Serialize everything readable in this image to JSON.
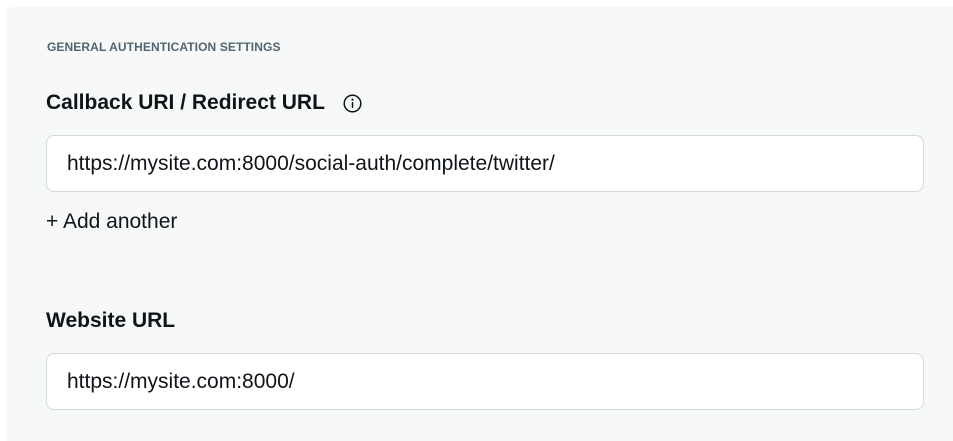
{
  "section": {
    "heading": "GENERAL AUTHENTICATION SETTINGS"
  },
  "callback": {
    "label": "Callback URI / Redirect URL",
    "info_icon": "info-circle-icon",
    "value": "https://mysite.com:8000/social-auth/complete/twitter/",
    "add_another_label": "+ Add another"
  },
  "website": {
    "label": "Website URL",
    "value": "https://mysite.com:8000/"
  },
  "colors": {
    "panel_background": "#f7f9f9",
    "input_border": "#cfd9de",
    "heading_text": "#536471",
    "primary_text": "#0f1419"
  }
}
